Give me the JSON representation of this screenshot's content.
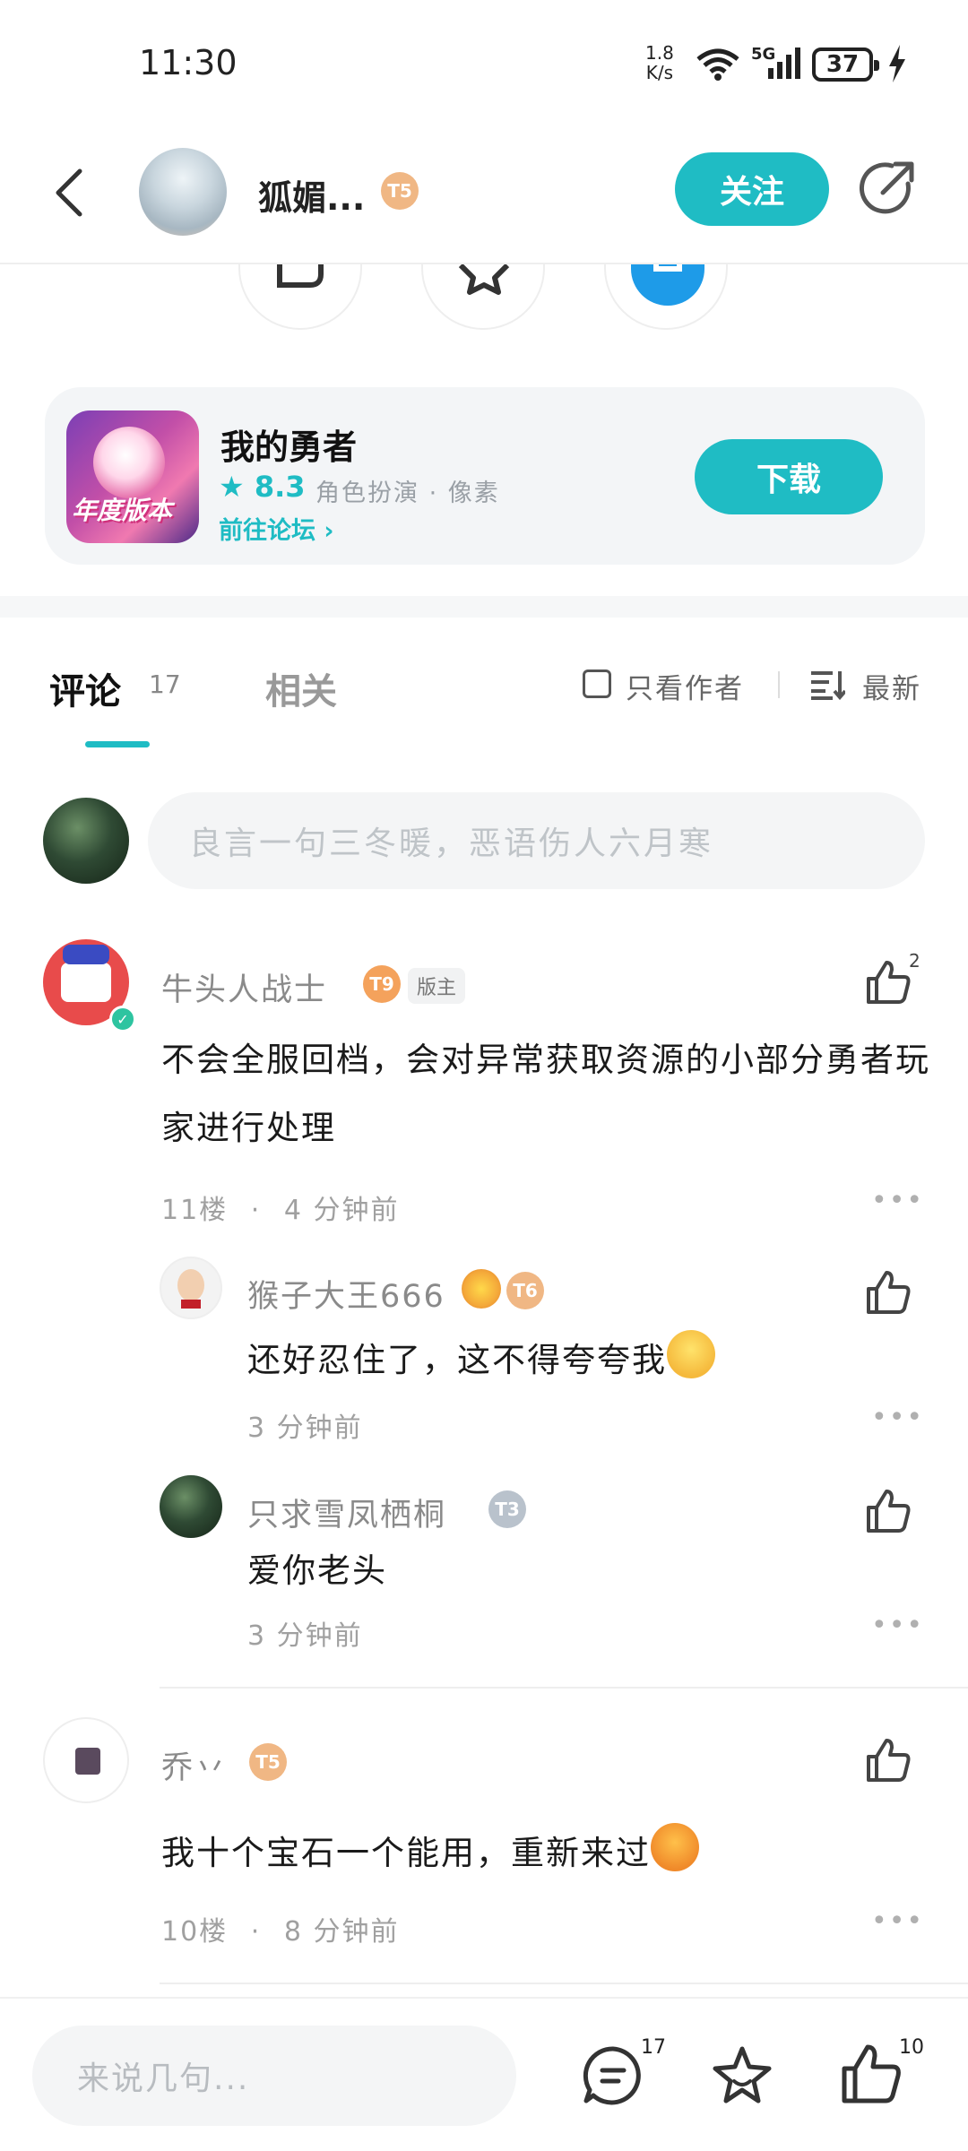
{
  "status_bar": {
    "time": "11:30",
    "speed_value": "1.8",
    "speed_unit": "K/s",
    "network": "5G",
    "battery": "37"
  },
  "header": {
    "author_name": "狐媚...",
    "author_level": "T5",
    "follow_label": "关注"
  },
  "game_card": {
    "name": "我的勇者",
    "rating": "8.3",
    "tags": "角色扮演 · 像素",
    "forum_link": "前往论坛",
    "download_label": "下载",
    "icon_banner": "年度版本"
  },
  "tabs": {
    "comments_label": "评论",
    "comments_count": "17",
    "related_label": "相关",
    "only_author_label": "只看作者",
    "sort_label": "最新"
  },
  "composer": {
    "placeholder": "良言一句三冬暖，恶语伤人六月寒"
  },
  "comments": [
    {
      "name": "牛头人战士",
      "level": "T9",
      "badge": "版主",
      "likes": "2",
      "text": "不会全服回档，会对异常获取资源的小部分勇者玩家进行处理",
      "floor": "11楼",
      "time": "4 分钟前",
      "replies": [
        {
          "name": "猴子大王666",
          "level": "T6",
          "text": "还好忍住了，这不得夸夸我",
          "time": "3 分钟前"
        },
        {
          "name": "只求雪凤栖桐",
          "level": "T3",
          "text": "爱你老头",
          "time": "3 分钟前"
        }
      ]
    },
    {
      "name": "乔丷",
      "level": "T5",
      "text": "我十个宝石一个能用，重新来过",
      "floor": "10楼",
      "time": "8 分钟前"
    }
  ],
  "bottom_bar": {
    "placeholder": "来说几句...",
    "comment_count": "17",
    "like_count": "10"
  },
  "colors": {
    "accent": "#1fbcc4",
    "level_badge": "#f0b784",
    "level_badge_grey": "#b9c2cc"
  }
}
